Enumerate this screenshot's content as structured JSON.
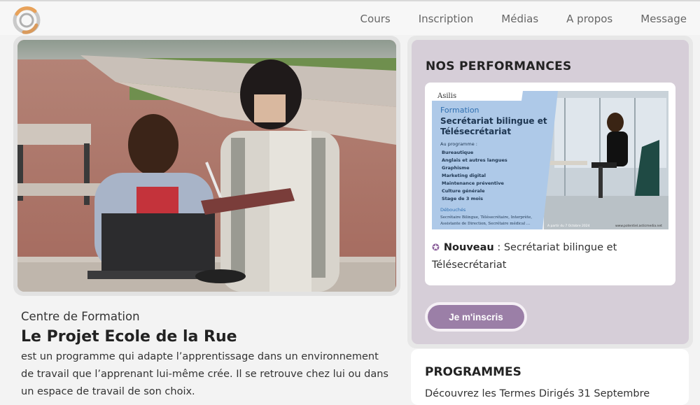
{
  "nav": {
    "items": [
      "Cours",
      "Inscription",
      "Médias",
      "A propos",
      "Message"
    ]
  },
  "hero": {
    "image_description_icon": "students-photo"
  },
  "about": {
    "kicker": "Centre de Formation",
    "title": "Le Projet Ecole de la Rue",
    "body": "est un programme qui adapte l’apprentissage dans un environnement de travail que l’apprenant lui-même crée. Il se retrouve chez lui ou dans un espace de travail de son choix."
  },
  "performances": {
    "title": "NOS PERFORMANCES",
    "flyer": {
      "brand": "Asilis",
      "kicker": "Formation",
      "heading_line1": "Secrétariat bilingue et",
      "heading_line2": "Télésecrétariat",
      "program_label": "Au programme :",
      "program_items": [
        "Bureautique",
        "Anglais et autres langues",
        "Graphisme",
        "Marketing digital",
        "Maintenance préventive",
        "Culture générale",
        "Stage de 3 mois"
      ],
      "outlets_label": "Débouchés",
      "outlets_line1": "Secrétaire Bilingue, Télésecrétaire, Interprète,",
      "outlets_line2": "Assistante de Direction, Secrétaire médical ...",
      "date_note": "A partir du 7 Octobre 2024",
      "website": "www.potentiel.asticmedia.net"
    },
    "news_label": "Nouveau",
    "news_text": " : Secrétariat bilingue et Télésecrétariat",
    "cta": "Je m'inscris"
  },
  "programmes": {
    "title": "PROGRAMMES",
    "body": "Découvrez les Termes Dirigés 31 Septembre"
  },
  "colors": {
    "accent": "#9b7fa7",
    "panel": "#d6ced8",
    "flyer_blue": "#aec9e8"
  }
}
